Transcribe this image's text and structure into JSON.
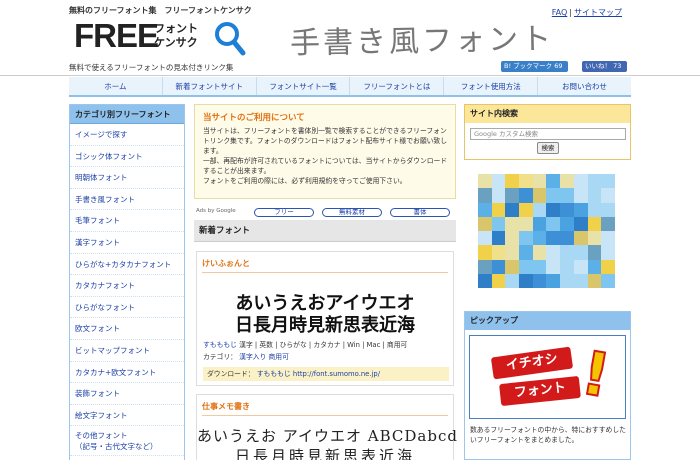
{
  "header": {
    "tagline": "無料のフリーフォント集　フリーフォントケンサク",
    "logo_free": "FREE",
    "logo_line1": "フォント",
    "logo_line2": "ケンサク",
    "subtagline": "無料で使えるフリーフォントの見本付きリンク集",
    "hero_text": "手書き風フォント",
    "links": [
      "FAQ",
      "サイトマップ"
    ],
    "link_separator": "|",
    "bookmark_label": "B! ブックマーク 69",
    "like_label": "いいね！ 73"
  },
  "nav": {
    "items": [
      "ホーム",
      "新着フォントサイト",
      "フォントサイト一覧",
      "フリーフォントとは",
      "フォント使用方法",
      "お問い合わせ"
    ]
  },
  "sidebar": {
    "title": "カテゴリ別フリーフォント",
    "items": [
      "イメージで探す",
      "ゴシック体フォント",
      "明朝体フォント",
      "手書き風フォント",
      "毛筆フォント",
      "漢字フォント",
      "ひらがな+カタカナフォント",
      "カタカナフォント",
      "ひらがなフォント",
      "欧文フォント",
      "ビットマップフォント",
      "カタカナ+欧文フォント",
      "装飾フォント",
      "絵文字フォント"
    ],
    "last_item_line1": "その他フォント",
    "last_item_line2": "（記号・古代文字など）"
  },
  "notice": {
    "title": "当サイトのご利用について",
    "body1": "当サイトは、フリーフォントを書体別一覧で検索することができるフリーフォントリンク集です。フォントのダウンロードはフォント配布サイト様でお願い致します。",
    "body2": "一部、再配布が許可されているフォントについては、当サイトからダウンロードすることが出来ます。",
    "body3": "フォントをご利用の際には、必ず利用規約を守ってご使用下さい。"
  },
  "ads": {
    "label": "Ads by Google",
    "pills": [
      "フリー",
      "無料素材",
      "書体"
    ]
  },
  "new_fonts": {
    "heading": "新着フォント",
    "cards": [
      {
        "title": "けいふぉんと",
        "sample1": "あいうえおアイウエオ",
        "sample2": "日長月時見新思表近海",
        "author": "すもももじ",
        "tags": "漢字 | 英数 | ひらがな | カタカナ | Win | Mac | 商用可",
        "category_label": "カテゴリ：",
        "category_links": [
          "漢字入り",
          "商用可"
        ],
        "download_label": "ダウンロード：",
        "download_site": "すもももじ",
        "download_url": "http://font.sumomo.ne.jp/"
      },
      {
        "title": "仕事メモ書き",
        "sample1": "あいうえお アイウエオ ABCDabcd",
        "sample2": "日長月時見新思表近海"
      }
    ]
  },
  "search": {
    "title": "サイト内検索",
    "placeholder": "Google カスタム検索",
    "button": "検索"
  },
  "pickup": {
    "title": "ピックアップ",
    "banner_line1": "イチオシ",
    "banner_line2": "フォント",
    "banner_mark": "!",
    "text": "数あるフリーフォントの中から、特におすすめしたいフリーフォントをまとめました。"
  },
  "colors": {
    "accent_orange": "#e07010",
    "nav_bg": "#e9f3fb",
    "sidebar_head": "#8ec1ec",
    "search_head": "#fbe69a",
    "notice_bg": "#fefbe8",
    "link_blue": "#1a3fa8"
  }
}
